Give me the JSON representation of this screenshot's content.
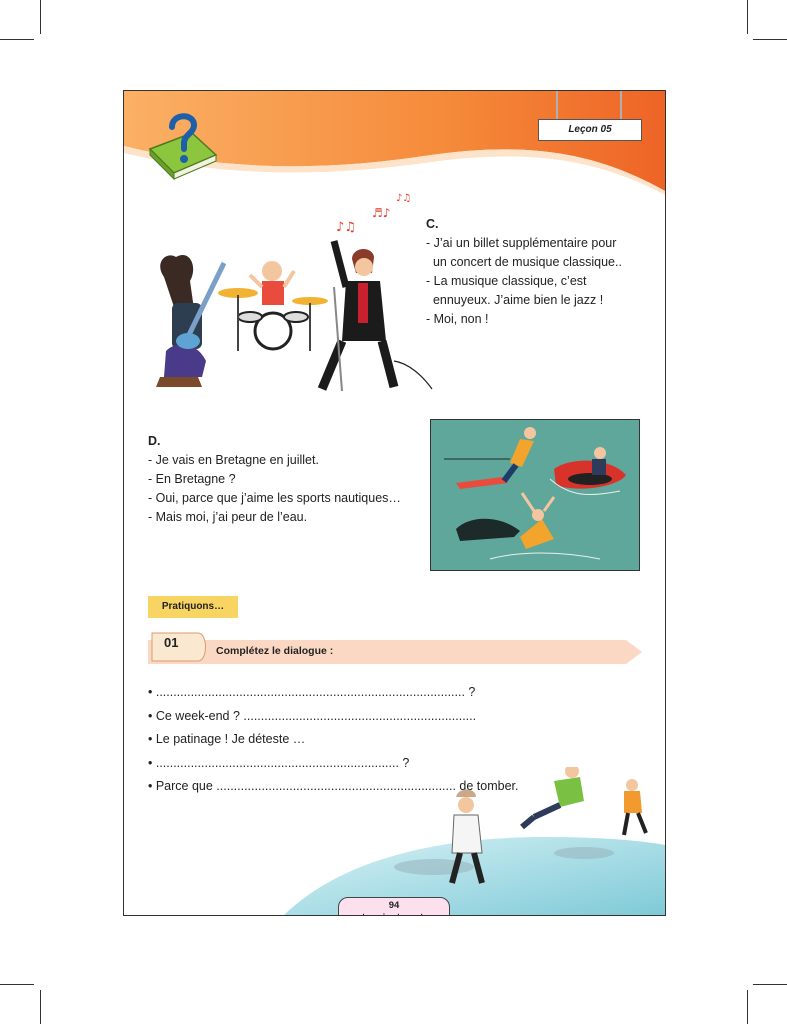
{
  "header": {
    "lesson_label": "Leçon 05"
  },
  "colors": {
    "banner_orange": "#f0752d",
    "banner_light": "#f8a85a",
    "tag_yellow": "#f8d463",
    "band_peach": "#fbd8c4",
    "water_teal": "#5fa79a",
    "ice_blue": "#a6dde6"
  },
  "dialogue_c": {
    "heading": "C.",
    "lines": [
      "- J’ai un billet supplémentaire pour",
      "  un concert de musique classique..",
      "- La musique classique, c’est",
      "  ennuyeux. J’aime bien le jazz !",
      "- Moi, non !"
    ]
  },
  "dialogue_d": {
    "heading": "D.",
    "lines": [
      "- Je vais en Bretagne en juillet.",
      "- En Bretagne ?",
      "- Oui, parce que j’aime les sports nautiques…",
      "- Mais moi, j’ai peur de l’eau."
    ]
  },
  "practice": {
    "label": "Pratiquons…",
    "exercise_number": "01",
    "exercise_title": "Complétez le dialogue :",
    "lines": [
      "• ......................................................................................... ?",
      "• Ce week-end ? ...................................................................",
      "• Le patinage ! Je déteste …",
      "• ...................................................................... ?",
      "• Parce que ..................................................................... de tomber."
    ]
  },
  "footer": {
    "page_number": "94",
    "page_words": "quatre-vingt-quatorze"
  },
  "icons": {
    "book": "question-book-icon",
    "band": "music-band-illustration",
    "water": "water-sports-illustration",
    "skate": "ice-skating-illustration"
  }
}
